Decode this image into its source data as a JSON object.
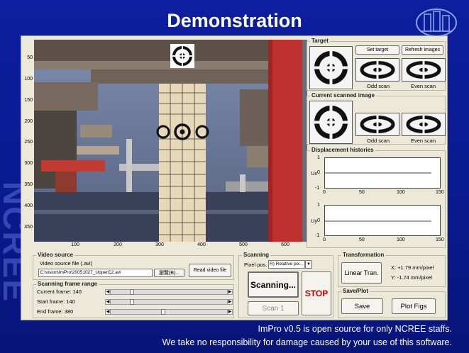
{
  "slide": {
    "title": "Demonstration",
    "watermark": "NCREE",
    "footer_line1": "ImPro v0.5 is open source for only NCREE staffs.",
    "footer_line2": "We take no responsibility for damage caused by your use of this software."
  },
  "video_axes": {
    "y_ticks": [
      "50",
      "100",
      "150",
      "200",
      "250",
      "300",
      "350",
      "400",
      "450"
    ],
    "x_ticks": [
      "100",
      "200",
      "300",
      "400",
      "500",
      "600"
    ]
  },
  "target": {
    "title": "Target",
    "set_target_label": "Set target",
    "refresh_label": "Refresh images",
    "odd_label": "Odd scan",
    "even_label": "Even scan"
  },
  "current_scanned": {
    "title": "Current scanned image",
    "odd_label": "Odd scan",
    "even_label": "Even scan"
  },
  "displacement": {
    "title": "Displacement histories",
    "ux_label": "Ux",
    "uy_label": "Uy",
    "y_ticks": [
      "1",
      "0",
      "-1"
    ],
    "x_ticks": [
      "0",
      "50",
      "100",
      "150"
    ]
  },
  "video_source": {
    "title": "Video source",
    "file_label": "Video source file (.avi)",
    "file_path": "C:\\vision\\ImPro\\20051027_UpperC2.avi",
    "browse_label": "瀏覽(B)...",
    "read_label": "Read video file"
  },
  "scanning_frame_range": {
    "title": "Scanning frame range",
    "current_frame": "Current frame: 140",
    "start_frame": "Start frame: 140",
    "end_frame": "End frame: 380"
  },
  "scanning": {
    "title": "Scanning",
    "pixel_pos_label": "Pixel pos.",
    "pixel_pos_value": "R) Relative pix...",
    "scanning_label": "Scanning...",
    "stop_label": "STOP",
    "scan1_label": "Scan 1"
  },
  "transformation": {
    "title": "Transformation",
    "linear_label": "Linear Tran.",
    "x_scale": "X: +1.79 mm/pixel",
    "y_scale": "Y: -1.74 mm/pixel"
  },
  "save_plot": {
    "title": "Save/Plot",
    "save_label": "Save",
    "plot_label": "Plot Figs"
  },
  "colors": {
    "background": "#0d1f9e",
    "stop_text": "#cc0000",
    "plot_line": "#000000"
  }
}
